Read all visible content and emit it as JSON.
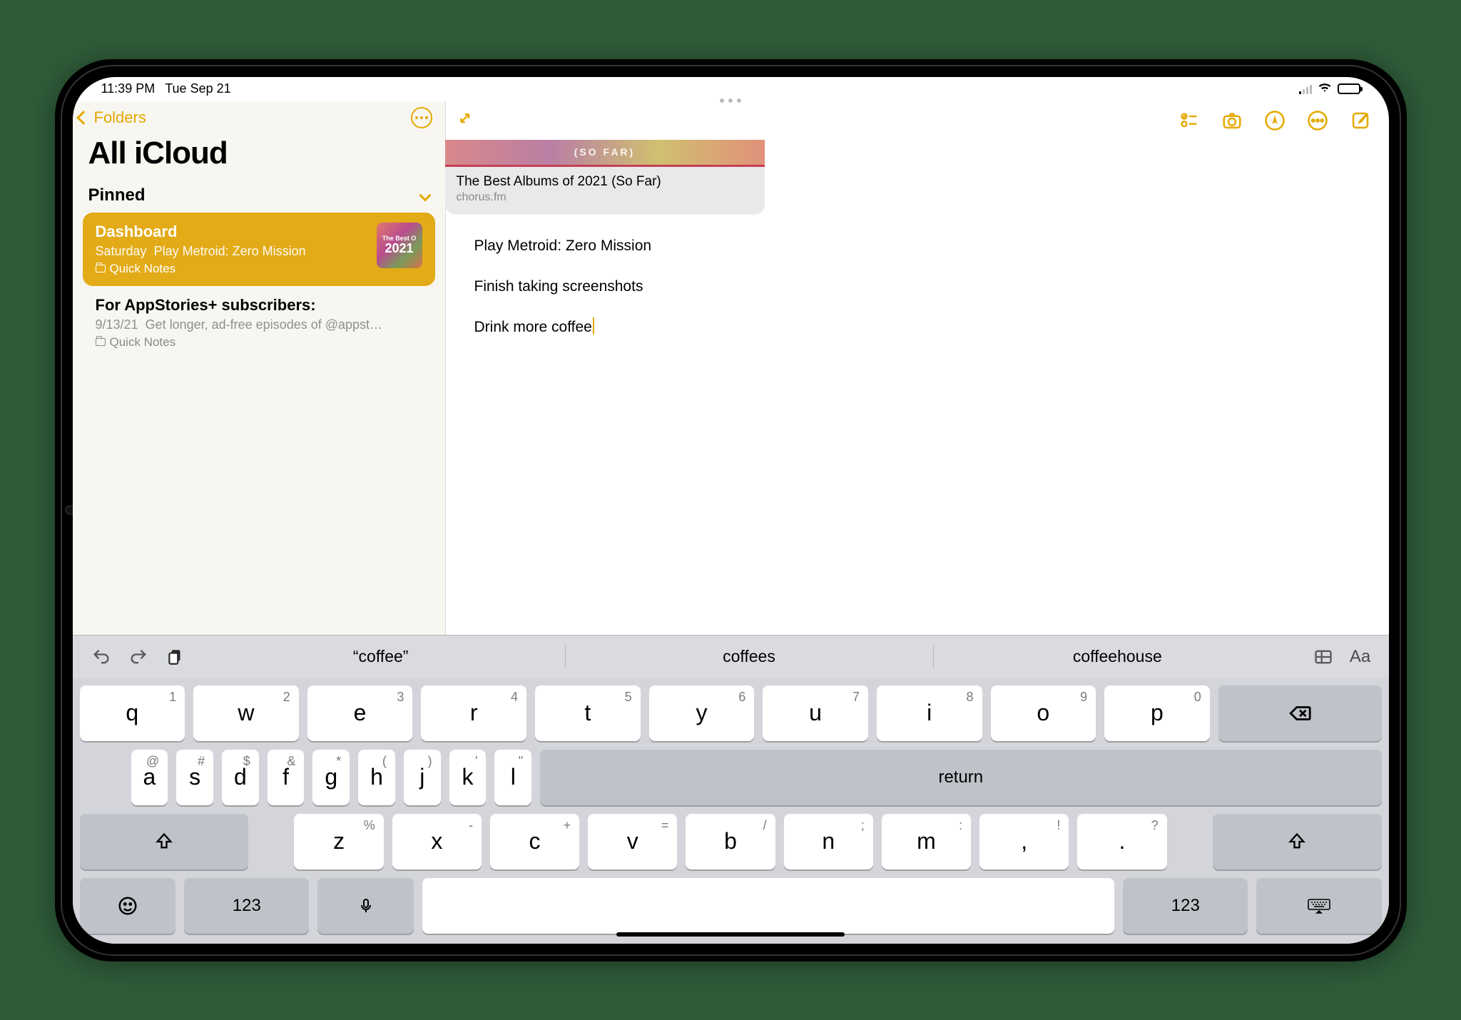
{
  "status": {
    "time": "11:39 PM",
    "date": "Tue Sep 21"
  },
  "sidebar": {
    "back_label": "Folders",
    "title": "All iCloud",
    "section": "Pinned",
    "items": [
      {
        "title": "Dashboard",
        "date": "Saturday",
        "preview": "Play Metroid: Zero Mission",
        "folder": "Quick Notes",
        "thumb_top": "The Best O",
        "thumb_year": "2021"
      },
      {
        "title": "For AppStories+ subscribers:",
        "date": "9/13/21",
        "preview": "Get longer, ad-free episodes of @appst…",
        "folder": "Quick Notes"
      }
    ]
  },
  "editor": {
    "link": {
      "hero": "(SO FAR)",
      "title": "The Best Albums of 2021 (So Far)",
      "domain": "chorus.fm"
    },
    "lines": [
      "Play Metroid: Zero Mission",
      "Finish taking screenshots",
      "Drink more coffee"
    ]
  },
  "keyboard": {
    "suggestions": [
      "“coffee”",
      "coffees",
      "coffeehouse"
    ],
    "row1": [
      {
        "l": "q",
        "a": "1"
      },
      {
        "l": "w",
        "a": "2"
      },
      {
        "l": "e",
        "a": "3"
      },
      {
        "l": "r",
        "a": "4"
      },
      {
        "l": "t",
        "a": "5"
      },
      {
        "l": "y",
        "a": "6"
      },
      {
        "l": "u",
        "a": "7"
      },
      {
        "l": "i",
        "a": "8"
      },
      {
        "l": "o",
        "a": "9"
      },
      {
        "l": "p",
        "a": "0"
      }
    ],
    "row2": [
      {
        "l": "a",
        "a": "@"
      },
      {
        "l": "s",
        "a": "#"
      },
      {
        "l": "d",
        "a": "$"
      },
      {
        "l": "f",
        "a": "&"
      },
      {
        "l": "g",
        "a": "*"
      },
      {
        "l": "h",
        "a": "("
      },
      {
        "l": "j",
        "a": ")"
      },
      {
        "l": "k",
        "a": "'"
      },
      {
        "l": "l",
        "a": "\""
      }
    ],
    "row3": [
      {
        "l": "z",
        "a": "%"
      },
      {
        "l": "x",
        "a": "-"
      },
      {
        "l": "c",
        "a": "+"
      },
      {
        "l": "v",
        "a": "="
      },
      {
        "l": "b",
        "a": "/"
      },
      {
        "l": "n",
        "a": ";"
      },
      {
        "l": "m",
        "a": ":"
      },
      {
        "l": ",",
        "a": "!"
      },
      {
        "l": ".",
        "a": "?"
      }
    ],
    "numkey": "123",
    "returnkey": "return",
    "format_label": "Aa"
  }
}
